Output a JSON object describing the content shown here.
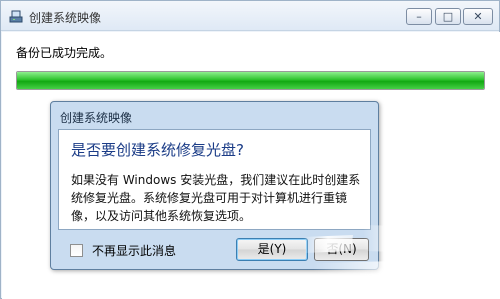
{
  "window": {
    "title": "创建系统映像",
    "status": "备份已成功完成。",
    "progress": 1.0,
    "controls": {
      "minimize": "–",
      "maximize": "□",
      "close": "✕"
    }
  },
  "dialog": {
    "title": "创建系统映像",
    "heading": "是否要创建系统修复光盘?",
    "message": "如果没有 Windows 安装光盘，我们建议在此时创建系统修复光盘。系统修复光盘可用于对计算机进行重镜像，以及访问其他系统恢复选项。",
    "checkbox_label": "不再显示此消息",
    "checkbox_checked": false,
    "yes_label": "是(Y)",
    "no_label": "否(N)"
  },
  "colors": {
    "progress": "#16a916",
    "heading": "#1b3c87"
  }
}
